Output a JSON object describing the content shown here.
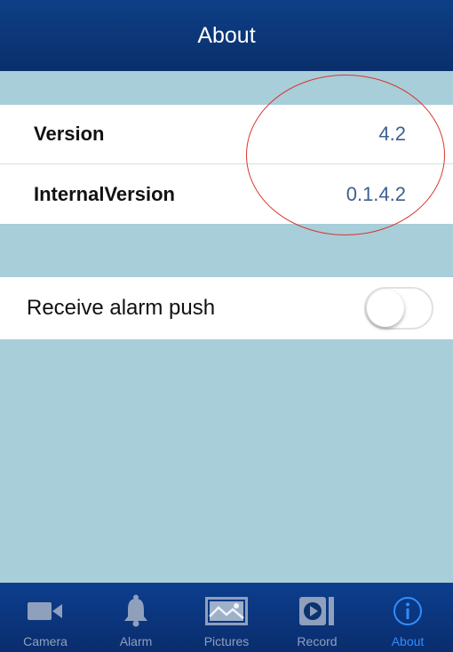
{
  "navbar": {
    "title": "About"
  },
  "info": {
    "version_label": "Version",
    "version_value": "4.2",
    "internal_label": "InternalVersion",
    "internal_value": "0.1.4.2"
  },
  "settings": {
    "alarm_push_label": "Receive alarm push",
    "alarm_push_enabled": false
  },
  "tabbar": {
    "active_tab": "About",
    "tabs": [
      {
        "label": "Camera",
        "icon": "camera-icon"
      },
      {
        "label": "Alarm",
        "icon": "bell-icon"
      },
      {
        "label": "Pictures",
        "icon": "picture-icon"
      },
      {
        "label": "Record",
        "icon": "record-icon"
      },
      {
        "label": "About",
        "icon": "info-icon"
      }
    ]
  },
  "colors": {
    "navbar": "#0e3f86",
    "background": "#a7ced9",
    "value_text": "#3e5f92",
    "annotation_circle": "#d8362f",
    "tab_inactive": "#8fa0bd",
    "tab_active": "#2f8eff"
  }
}
